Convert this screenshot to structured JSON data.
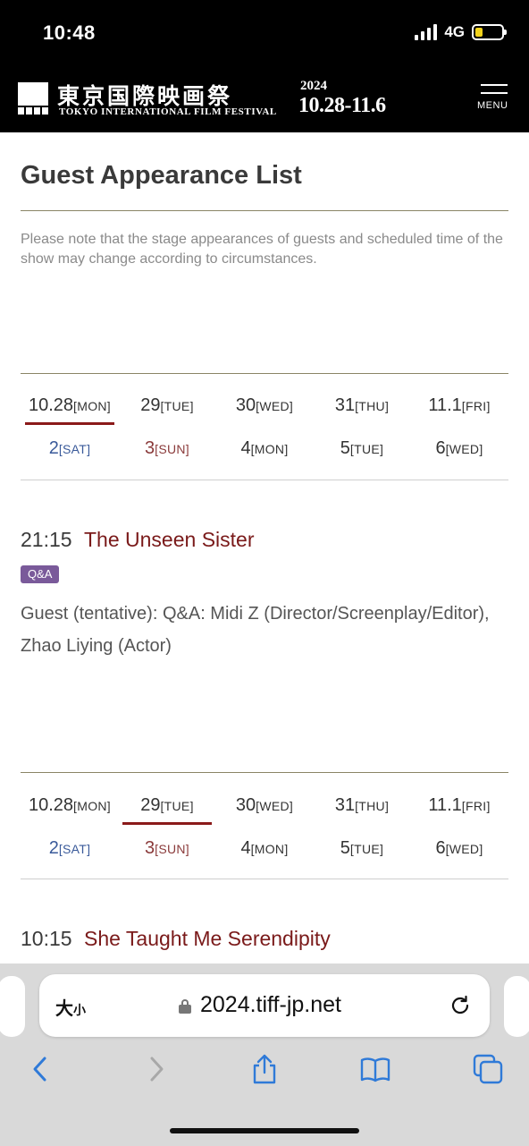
{
  "status": {
    "time": "10:48",
    "network": "4G"
  },
  "header": {
    "logo_jp": "東京国際映画祭",
    "logo_en": "TOKYO INTERNATIONAL FILM FESTIVAL",
    "year": "2024",
    "dates": "10.28-11.6",
    "menu_label": "MENU"
  },
  "page": {
    "title": "Guest Appearance List",
    "note": "Please note that the stage appearances of guests and scheduled time of the show may change according to circumstances."
  },
  "date_nav": {
    "row1": [
      {
        "day": "10.28",
        "dow": "[MON]"
      },
      {
        "day": "29",
        "dow": "[TUE]"
      },
      {
        "day": "30",
        "dow": "[WED]"
      },
      {
        "day": "31",
        "dow": "[THU]"
      },
      {
        "day": "11.1",
        "dow": "[FRI]"
      }
    ],
    "row2": [
      {
        "day": "2",
        "dow": "[SAT]"
      },
      {
        "day": "3",
        "dow": "[SUN]"
      },
      {
        "day": "4",
        "dow": "[MON]"
      },
      {
        "day": "5",
        "dow": "[TUE]"
      },
      {
        "day": "6",
        "dow": "[WED]"
      }
    ]
  },
  "events": [
    {
      "time": "21:15",
      "title": "The Unseen Sister",
      "badge": "Q&A",
      "guest": "Guest (tentative): Q&A: Midi Z (Director/Screenplay/Editor), Zhao Liying (Actor)"
    },
    {
      "time": "10:15",
      "title": "She Taught Me Serendipity"
    }
  ],
  "browser": {
    "text_size_label": "大",
    "text_size_small": "小",
    "url": "2024.tiff-jp.net"
  },
  "colors": {
    "accent": "#7a1a1a",
    "badge": "#7a5a9a",
    "rule": "#8a8566"
  }
}
